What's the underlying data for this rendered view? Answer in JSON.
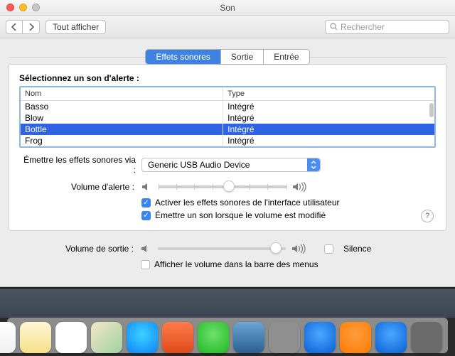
{
  "window": {
    "title": "Son"
  },
  "toolbar": {
    "show_all": "Tout afficher",
    "search_placeholder": "Rechercher"
  },
  "tabs": [
    {
      "label": "Effets sonores",
      "active": true
    },
    {
      "label": "Sortie",
      "active": false
    },
    {
      "label": "Entrée",
      "active": false
    }
  ],
  "alert_section": {
    "heading": "Sélectionnez un son d'alerte :",
    "columns": {
      "name": "Nom",
      "type": "Type"
    },
    "rows": [
      {
        "name": "Basso",
        "type": "Intégré",
        "selected": false
      },
      {
        "name": "Blow",
        "type": "Intégré",
        "selected": false
      },
      {
        "name": "Bottle",
        "type": "Intégré",
        "selected": true
      },
      {
        "name": "Frog",
        "type": "Intégré",
        "selected": false
      }
    ]
  },
  "output_device": {
    "label": "Émettre les effets sonores via :",
    "value": "Generic USB Audio Device"
  },
  "alert_volume": {
    "label": "Volume d'alerte :",
    "value_pct": 55
  },
  "checkboxes": {
    "ui_sounds": {
      "label": "Activer les effets sonores de l'interface utilisateur",
      "checked": true
    },
    "volume_feedback": {
      "label": "Émettre un son lorsque le volume est modifié",
      "checked": true
    }
  },
  "output_volume": {
    "label": "Volume de sortie :",
    "value_pct": 92,
    "mute": {
      "label": "Silence",
      "checked": false
    }
  },
  "menubar_volume": {
    "label": "Afficher le volume dans la barre des menus",
    "checked": false
  },
  "dock_apps": [
    "calendar",
    "notes",
    "reminders",
    "maps",
    "messages-blue",
    "photo-booth",
    "messages-green",
    "photos",
    "launchpad",
    "itunes",
    "ibooks",
    "app-store",
    "system-preferences"
  ]
}
